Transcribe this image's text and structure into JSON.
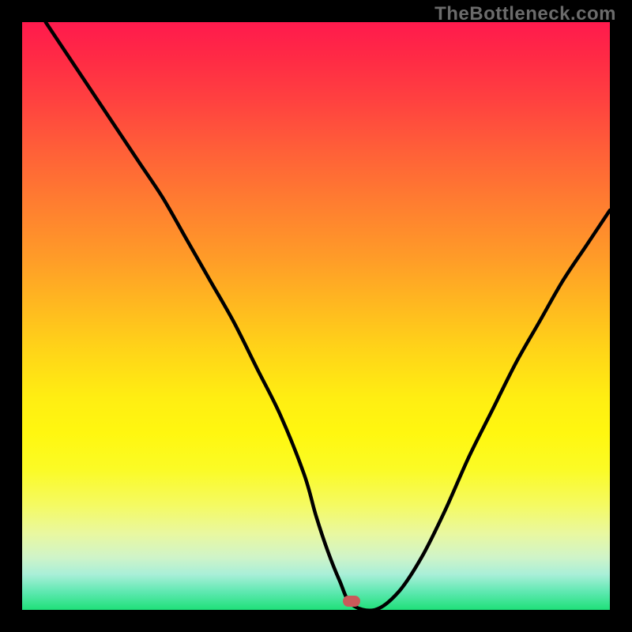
{
  "watermark": "TheBottleneck.com",
  "chart_data": {
    "type": "line",
    "title": "",
    "xlabel": "",
    "ylabel": "",
    "xlim": [
      0,
      100
    ],
    "ylim": [
      0,
      100
    ],
    "grid": false,
    "background_gradient": {
      "top": "#ff1a4d",
      "middle": "#ffd518",
      "bottom": "#1fe079"
    },
    "series": [
      {
        "name": "bottleneck-curve",
        "x": [
          4,
          8,
          12,
          16,
          20,
          24,
          28,
          32,
          36,
          40,
          44,
          48,
          50,
          52,
          54,
          56,
          60,
          64,
          68,
          72,
          76,
          80,
          84,
          88,
          92,
          96,
          100
        ],
        "values": [
          100,
          94,
          88,
          82,
          76,
          70,
          63,
          56,
          49,
          41,
          33,
          23,
          16,
          10,
          5,
          1,
          0,
          3,
          9,
          17,
          26,
          34,
          42,
          49,
          56,
          62,
          68
        ]
      }
    ],
    "marker": {
      "x_percent": 56,
      "y_percent": 1.5,
      "color": "#c95a5a",
      "label": "optimal-point"
    }
  }
}
